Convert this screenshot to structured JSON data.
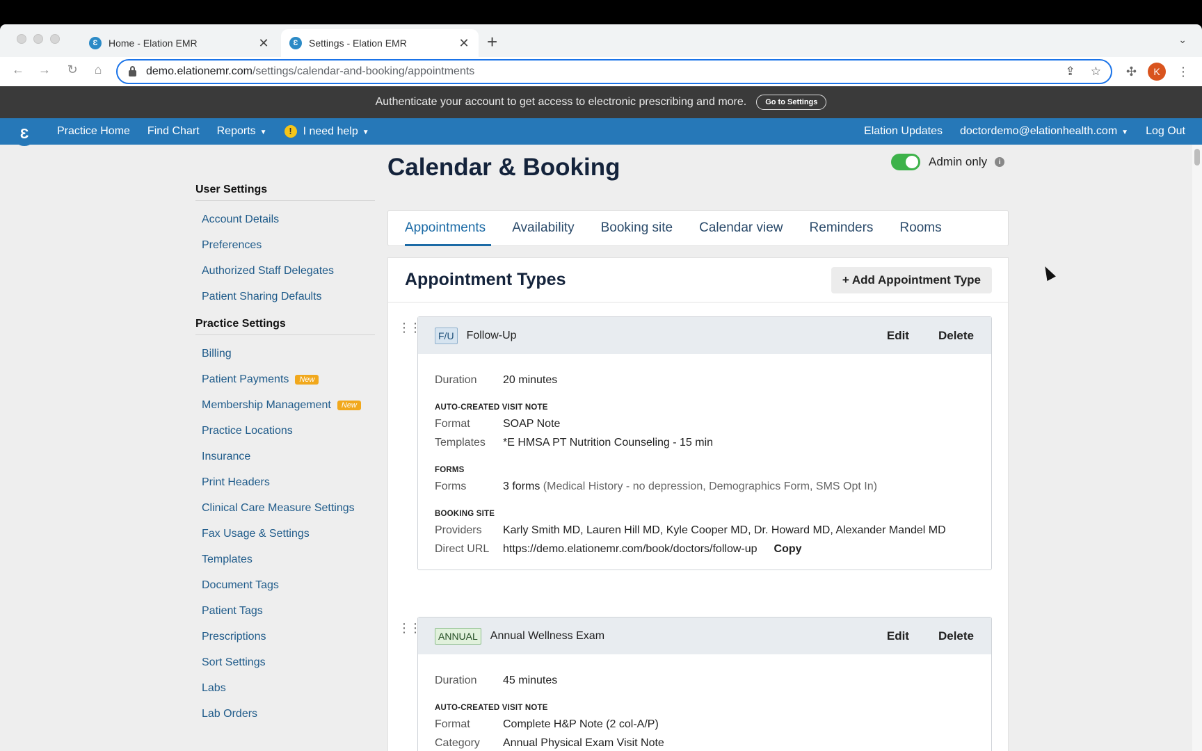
{
  "browser": {
    "tabs": [
      {
        "title": "Home - Elation EMR",
        "favicon": "Ɛ"
      },
      {
        "title": "Settings - Elation EMR",
        "favicon": "Ɛ"
      }
    ],
    "url_host": "demo.elationemr.com",
    "url_path": "/settings/calendar-and-booking/appointments",
    "profile_initial": "K",
    "icons": {
      "back": "←",
      "forward": "→",
      "reload": "↻",
      "home": "⌂",
      "share": "⇪",
      "star": "☆",
      "extensions": "✣",
      "menu": "⋮",
      "close": "✕",
      "new_tab": "+",
      "tab_menu": "⌄"
    }
  },
  "banner": {
    "text": "Authenticate your account to get access to electronic prescribing and more.",
    "button": "Go to Settings"
  },
  "navbar": {
    "logo": "Ɛ",
    "practice_home": "Practice Home",
    "find_chart": "Find Chart",
    "reports": "Reports",
    "help": "I need help",
    "updates": "Elation Updates",
    "user": "doctordemo@elationhealth.com",
    "logout": "Log Out"
  },
  "sidebar": {
    "user_settings_title": "User Settings",
    "user_items": [
      "Account Details",
      "Preferences",
      "Authorized Staff Delegates",
      "Patient Sharing Defaults"
    ],
    "practice_settings_title": "Practice Settings",
    "practice_items": [
      "Billing",
      "Patient Payments",
      "Membership Management",
      "Practice Locations",
      "Insurance",
      "Print Headers",
      "Clinical Care Measure Settings",
      "Fax Usage & Settings",
      "Templates",
      "Document Tags",
      "Patient Tags",
      "Prescriptions",
      "Sort Settings",
      "Labs",
      "Lab Orders"
    ],
    "new_badge": "New"
  },
  "page": {
    "title": "Calendar & Booking",
    "admin_only": "Admin only",
    "admin_only_enabled": true,
    "tabs": [
      "Appointments",
      "Availability",
      "Booking site",
      "Calendar view",
      "Reminders",
      "Rooms"
    ],
    "active_tab": "Appointments"
  },
  "appointment_types": {
    "title": "Appointment Types",
    "add_button": "+ Add Appointment Type",
    "edit_label": "Edit",
    "delete_label": "Delete",
    "labels": {
      "duration": "Duration",
      "auto_note": "AUTO-CREATED VISIT NOTE",
      "format": "Format",
      "templates": "Templates",
      "category": "Category",
      "forms_head": "FORMS",
      "forms": "Forms",
      "booking_site": "BOOKING SITE",
      "providers": "Providers",
      "direct_url": "Direct URL",
      "copy": "Copy"
    },
    "items": [
      {
        "abbr": "F/U",
        "name": "Follow-Up",
        "duration": "20 minutes",
        "format": "SOAP Note",
        "templates": "*E HMSA PT Nutrition Counseling - 15 min",
        "forms_count": "3 forms",
        "forms_detail": "(Medical History - no depression, Demographics Form, SMS Opt In)",
        "providers": "Karly Smith MD, Lauren Hill MD, Kyle Cooper MD, Dr. Howard MD, Alexander Mandel MD",
        "direct_url": "https://demo.elationemr.com/book/doctors/follow-up"
      },
      {
        "abbr": "ANNUAL",
        "name": "Annual Wellness Exam",
        "duration": "45 minutes",
        "format": "Complete H&P Note (2 col-A/P)",
        "category": "Annual Physical Exam Visit Note"
      }
    ]
  }
}
